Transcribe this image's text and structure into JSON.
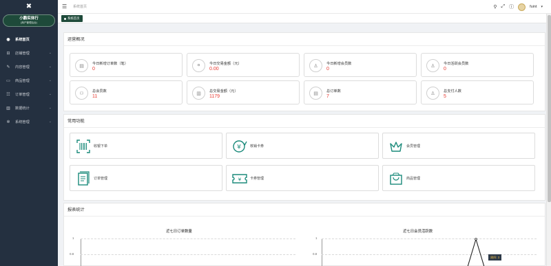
{
  "sidebar": {
    "store_name": "小鹏实体行",
    "store_sub": "(商户管理后台)",
    "items": [
      {
        "label": "系统首页",
        "icon": "home-icon",
        "glyph": "◉",
        "active": true,
        "chev": ""
      },
      {
        "label": "店铺管理",
        "icon": "store-icon",
        "glyph": "⊟",
        "active": false,
        "chev": "⌄"
      },
      {
        "label": "内容管理",
        "icon": "edit-icon",
        "glyph": "✎",
        "active": false,
        "chev": "⌄"
      },
      {
        "label": "商品管理",
        "icon": "goods-icon",
        "glyph": "▭",
        "active": false,
        "chev": "⌄"
      },
      {
        "label": "订单管理",
        "icon": "order-icon",
        "glyph": "☷",
        "active": false,
        "chev": "⌄"
      },
      {
        "label": "数据统计",
        "icon": "stats-icon",
        "glyph": "▥",
        "active": false,
        "chev": "⌄"
      },
      {
        "label": "系统管理",
        "icon": "settings-icon",
        "glyph": "✲",
        "active": false,
        "chev": "⌄"
      }
    ]
  },
  "topbar": {
    "breadcrumb": "系统首页",
    "username": "fuint",
    "dropdown": "▾"
  },
  "tab": {
    "label": "系统首页"
  },
  "overview": {
    "title": "运营概况",
    "stats": [
      {
        "label": "今日新增订单数（笔）",
        "value": "0",
        "icon": "receipt-icon",
        "glyph": "▤"
      },
      {
        "label": "今日交易金额（元）",
        "value": "0.00",
        "icon": "money-icon",
        "glyph": "¤"
      },
      {
        "label": "今日新增会员数",
        "value": "0",
        "icon": "user-add-icon",
        "glyph": "♙"
      },
      {
        "label": "今日活跃会员数",
        "value": "0",
        "icon": "user-active-icon",
        "glyph": "♙"
      },
      {
        "label": "总会员数",
        "value": "11",
        "icon": "members-icon",
        "glyph": "⚇"
      },
      {
        "label": "总交易金额（元）",
        "value": "1179",
        "icon": "chart-bars-icon",
        "glyph": "▥"
      },
      {
        "label": "总订单数",
        "value": "7",
        "icon": "orders-icon",
        "glyph": "▤"
      },
      {
        "label": "总支付人数",
        "value": "5",
        "icon": "payer-icon",
        "glyph": "♙"
      }
    ]
  },
  "functions": {
    "title": "常用功能",
    "items": [
      {
        "label": "收银下单",
        "icon": "barcode-icon"
      },
      {
        "label": "核销卡券",
        "icon": "verify-coupon-icon"
      },
      {
        "label": "会员管理",
        "icon": "crown-icon"
      },
      {
        "label": "订单管理",
        "icon": "document-icon"
      },
      {
        "label": "卡券管理",
        "icon": "ticket-icon"
      },
      {
        "label": "商品管理",
        "icon": "shopping-bag-icon"
      }
    ]
  },
  "report": {
    "title": "报表统计",
    "accent": "#1e4a3a"
  },
  "chart_data": [
    {
      "type": "line",
      "title": "近七日订单数量",
      "y_ticks": [
        "1",
        "0.8"
      ],
      "ylim": [
        0,
        1
      ]
    },
    {
      "type": "line",
      "title": "近七日会员活跃数",
      "y_ticks": [
        "1",
        "0.8"
      ],
      "ylim": [
        0,
        1
      ],
      "tooltip": "周四: 3"
    }
  ]
}
